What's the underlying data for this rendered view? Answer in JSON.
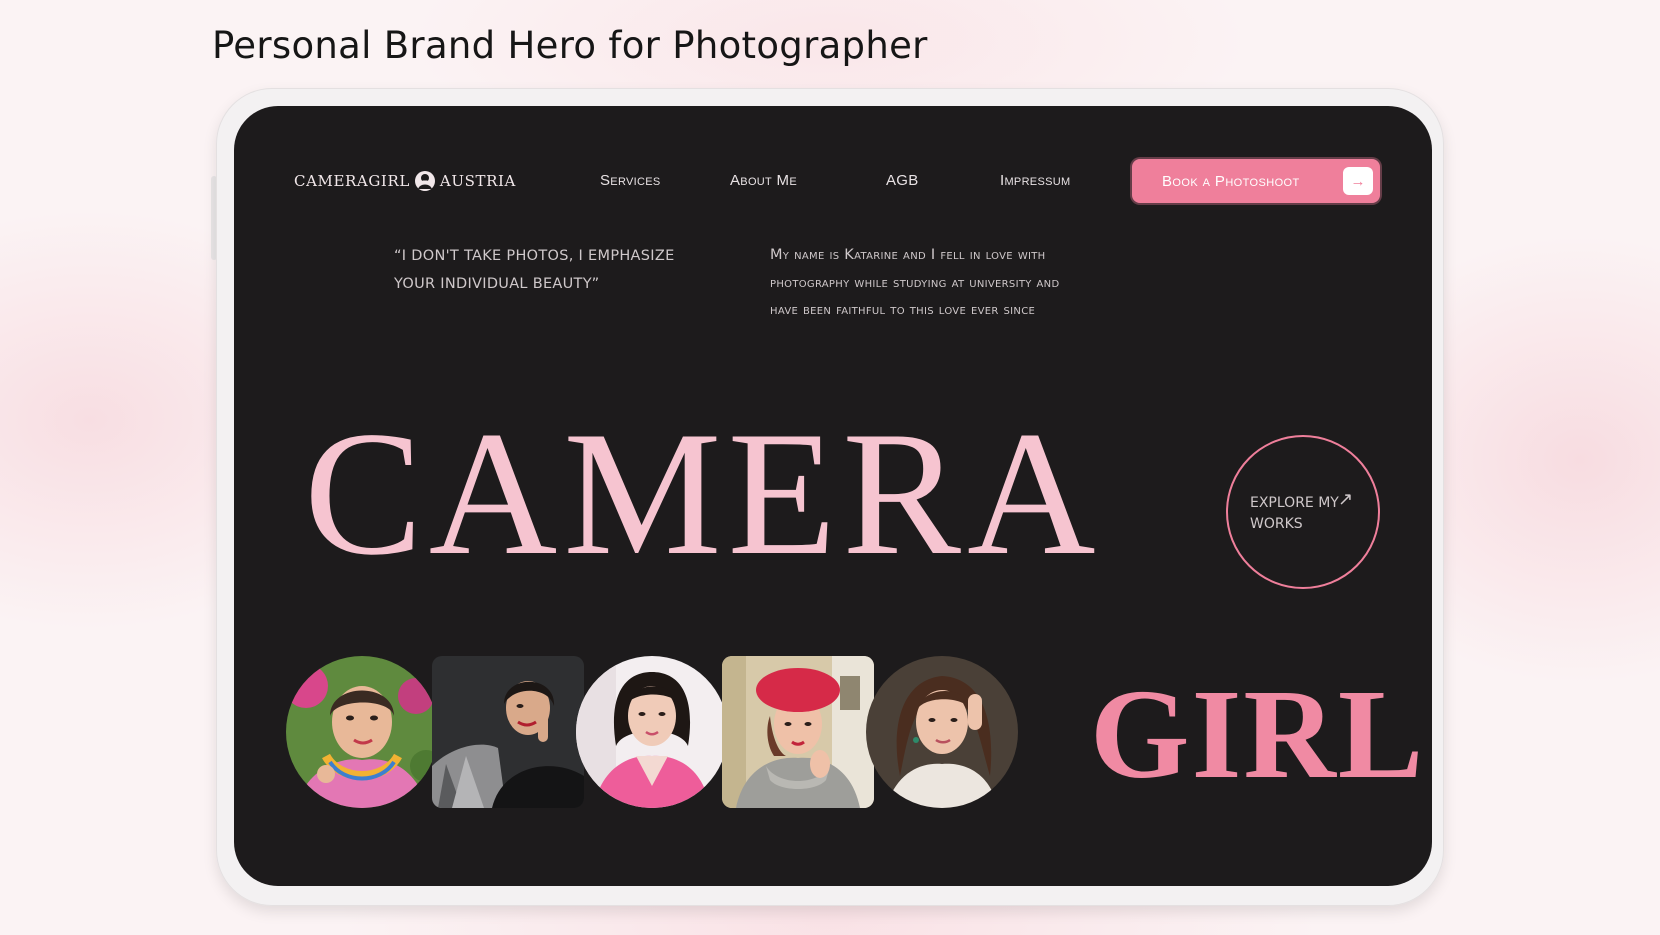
{
  "page_heading": "Personal Brand Hero for Photographer",
  "brand": {
    "logo_text_left": "CAMERAGIRL",
    "logo_text_right": "AUSTRIA"
  },
  "nav": {
    "items": [
      {
        "label": "Services"
      },
      {
        "label": "About Me"
      },
      {
        "label": "AGB"
      },
      {
        "label": "Impressum"
      }
    ],
    "cta_label": "Book a Photoshoot"
  },
  "hero": {
    "quote": "“I don't take photos, I emphasize your individual beauty”",
    "bio": "My name is Katarine and I fell in love with photography while studying at university and have been faithful to this love ever since",
    "headline_top": "CAMERA",
    "headline_bottom": "GIRL",
    "explore_label": "EXPLORE MY WORKS"
  },
  "gallery": {
    "photos": [
      {
        "shape": "round",
        "subject": "woman with colorful necklace"
      },
      {
        "shape": "rect",
        "subject": "woman in grey blazer"
      },
      {
        "shape": "round",
        "subject": "woman in pink jacket"
      },
      {
        "shape": "rect",
        "subject": "woman with red beret"
      },
      {
        "shape": "round",
        "subject": "woman with long dark hair"
      }
    ]
  },
  "colors": {
    "accent_pink": "#ef7f9b",
    "light_pink": "#f6c4d0",
    "screen_bg": "#1d1b1c"
  }
}
